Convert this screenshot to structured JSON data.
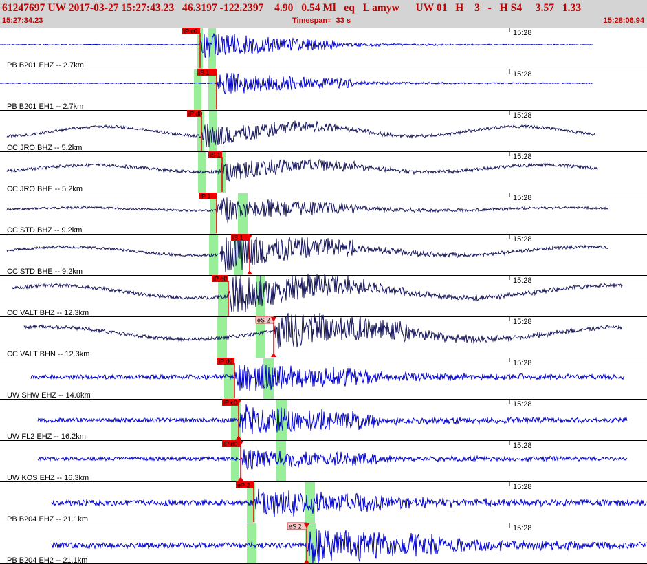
{
  "header": {
    "title": "61247697 UW 2017-03-27 15:27:43.23   46.3197 -122.2397    4.90   0.54 Ml   eq   L amyw      UW 01   H    3   -   H S4     3.57   1.33",
    "start_time": "15:27:34.23",
    "timespan": "Timespan=  33 s",
    "end_time": "15:28:06.94"
  },
  "colors": {
    "header_bg": "#d4d4d4",
    "header_text": "#c00000",
    "trace_blue": "#0000cc",
    "trace_navy": "#14145a",
    "pick_red": "#ee0000",
    "pick_pink": "#f4c8c8",
    "window_green": "#99ee99"
  },
  "panels": [
    {
      "label": "PB B201 EHZ -- 2.7km",
      "time": "15:28",
      "color": "trace_blue",
      "pick": {
        "label": "iP c0",
        "box": "red",
        "arrow": false
      },
      "greens": [
        [
          287,
          295
        ],
        [
          303,
          314
        ]
      ]
    },
    {
      "label": "PB B201 EH1 -- 2.7km",
      "time": "15:28",
      "color": "trace_blue",
      "pick": {
        "label": "iS 1",
        "box": "red",
        "arrow": false
      },
      "greens": [
        [
          282,
          293
        ],
        [
          303,
          315
        ]
      ]
    },
    {
      "label": "CC JRO BHZ -- 5.2km",
      "time": "15:28",
      "color": "trace_navy",
      "pick": {
        "label": "iP d0",
        "box": "red",
        "arrow": false
      },
      "greens": [
        [
          287,
          297
        ],
        [
          304,
          316
        ]
      ]
    },
    {
      "label": "CC JRO BHE -- 5.2km",
      "time": "15:28",
      "color": "trace_navy",
      "pick": {
        "label": "iS 1",
        "box": "red",
        "arrow": false
      },
      "greens": [
        [
          288,
          299
        ],
        [
          316,
          328
        ]
      ]
    },
    {
      "label": "CC STD BHZ -- 9.2km",
      "time": "15:28",
      "color": "trace_navy",
      "pick": {
        "label": "iP 1",
        "box": "red",
        "arrow": false
      },
      "greens": [
        [
          305,
          315
        ],
        [
          346,
          360
        ]
      ]
    },
    {
      "label": "CC STD BHE -- 9.2km",
      "time": "15:28",
      "color": "trace_navy",
      "pick": {
        "label": "iS 1",
        "box": "red",
        "arrow": true
      },
      "greens": [
        [
          304,
          317
        ],
        [
          340,
          354
        ]
      ]
    },
    {
      "label": "CC VALT BHZ -- 12.3km",
      "time": "15:28",
      "color": "trace_navy",
      "pick": {
        "label": "iP d0",
        "box": "red",
        "arrow": false
      },
      "greens": [
        [
          317,
          332
        ],
        [
          372,
          386
        ]
      ]
    },
    {
      "label": "CC VALT BHN -- 12.3km",
      "time": "15:28",
      "color": "trace_navy",
      "pick": {
        "label": "eS 2",
        "box": "pink",
        "arrow": true
      },
      "greens": [
        [
          316,
          330
        ],
        [
          372,
          386
        ]
      ]
    },
    {
      "label": "UW SHW EHZ -- 14.0km",
      "time": "15:28",
      "color": "trace_blue",
      "pick": {
        "label": "iP d0",
        "box": "red",
        "arrow": false
      },
      "greens": [
        [
          326,
          341
        ],
        [
          383,
          398
        ]
      ]
    },
    {
      "label": "UW FL2 EHZ -- 16.2km",
      "time": "15:28",
      "color": "trace_blue",
      "pick": {
        "label": "iP c0",
        "box": "red",
        "arrow": true
      },
      "greens": [
        [
          336,
          350
        ],
        [
          401,
          417
        ]
      ]
    },
    {
      "label": "UW KOS EHZ -- 16.3km",
      "time": "15:28",
      "color": "trace_blue",
      "pick": {
        "label": "iP d0",
        "box": "red",
        "arrow": true
      },
      "greens": [
        [
          336,
          348
        ],
        [
          402,
          416
        ]
      ]
    },
    {
      "label": "PB B204 EHZ -- 21.1km",
      "time": "15:28",
      "color": "trace_blue",
      "pick": {
        "label": "eP 2",
        "box": "red",
        "arrow": false
      },
      "greens": [
        [
          359,
          371
        ],
        [
          443,
          458
        ]
      ]
    },
    {
      "label": "PB B204 EH2 -- 21.1km",
      "time": "15:28",
      "color": "trace_blue",
      "pick": {
        "label": "eS 2",
        "box": "pink",
        "arrow": true
      },
      "greens": [
        [
          359,
          373
        ],
        [
          443,
          459
        ]
      ]
    }
  ]
}
